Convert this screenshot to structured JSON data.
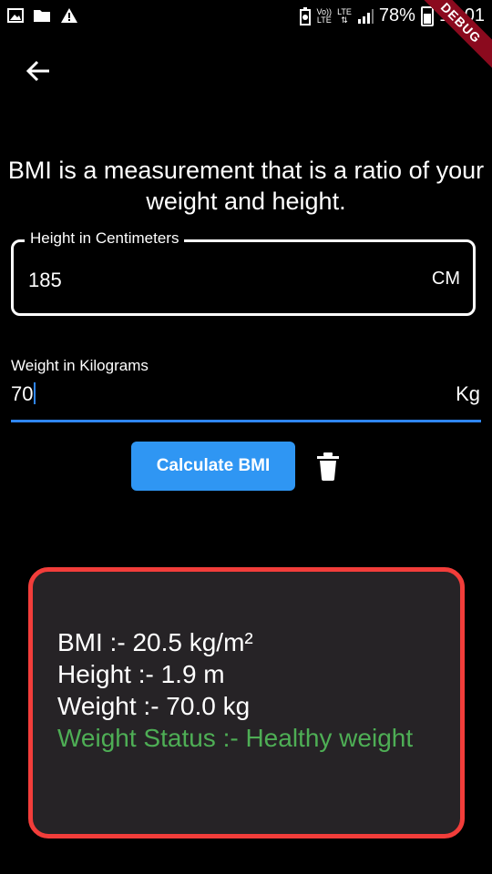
{
  "status_bar": {
    "network_top": "Vo))",
    "network_bottom": "LTE",
    "lte_top": "LTE",
    "lte_bottom": "⇅",
    "battery_percent": "78%",
    "time": "16:01",
    "debug_banner": "DEBUG"
  },
  "intro_text": "BMI is a measurement that is a ratio of your weight and height.",
  "height_field": {
    "label": "Height in Centimeters",
    "value": "185",
    "suffix": "CM"
  },
  "weight_field": {
    "label": "Weight in Kilograms",
    "value": "70",
    "suffix": "Kg"
  },
  "calculate_button_label": "Calculate BMI",
  "result": {
    "bmi_line": "BMI :- 20.5 kg/m²",
    "height_line": "Height :- 1.9 m",
    "weight_line": "Weight :- 70.0 kg",
    "status_line": "Weight Status :- Healthy weight"
  },
  "colors": {
    "accent": "#2f96f3",
    "card_border": "#f23d3a",
    "healthy_text": "#4eae55"
  }
}
